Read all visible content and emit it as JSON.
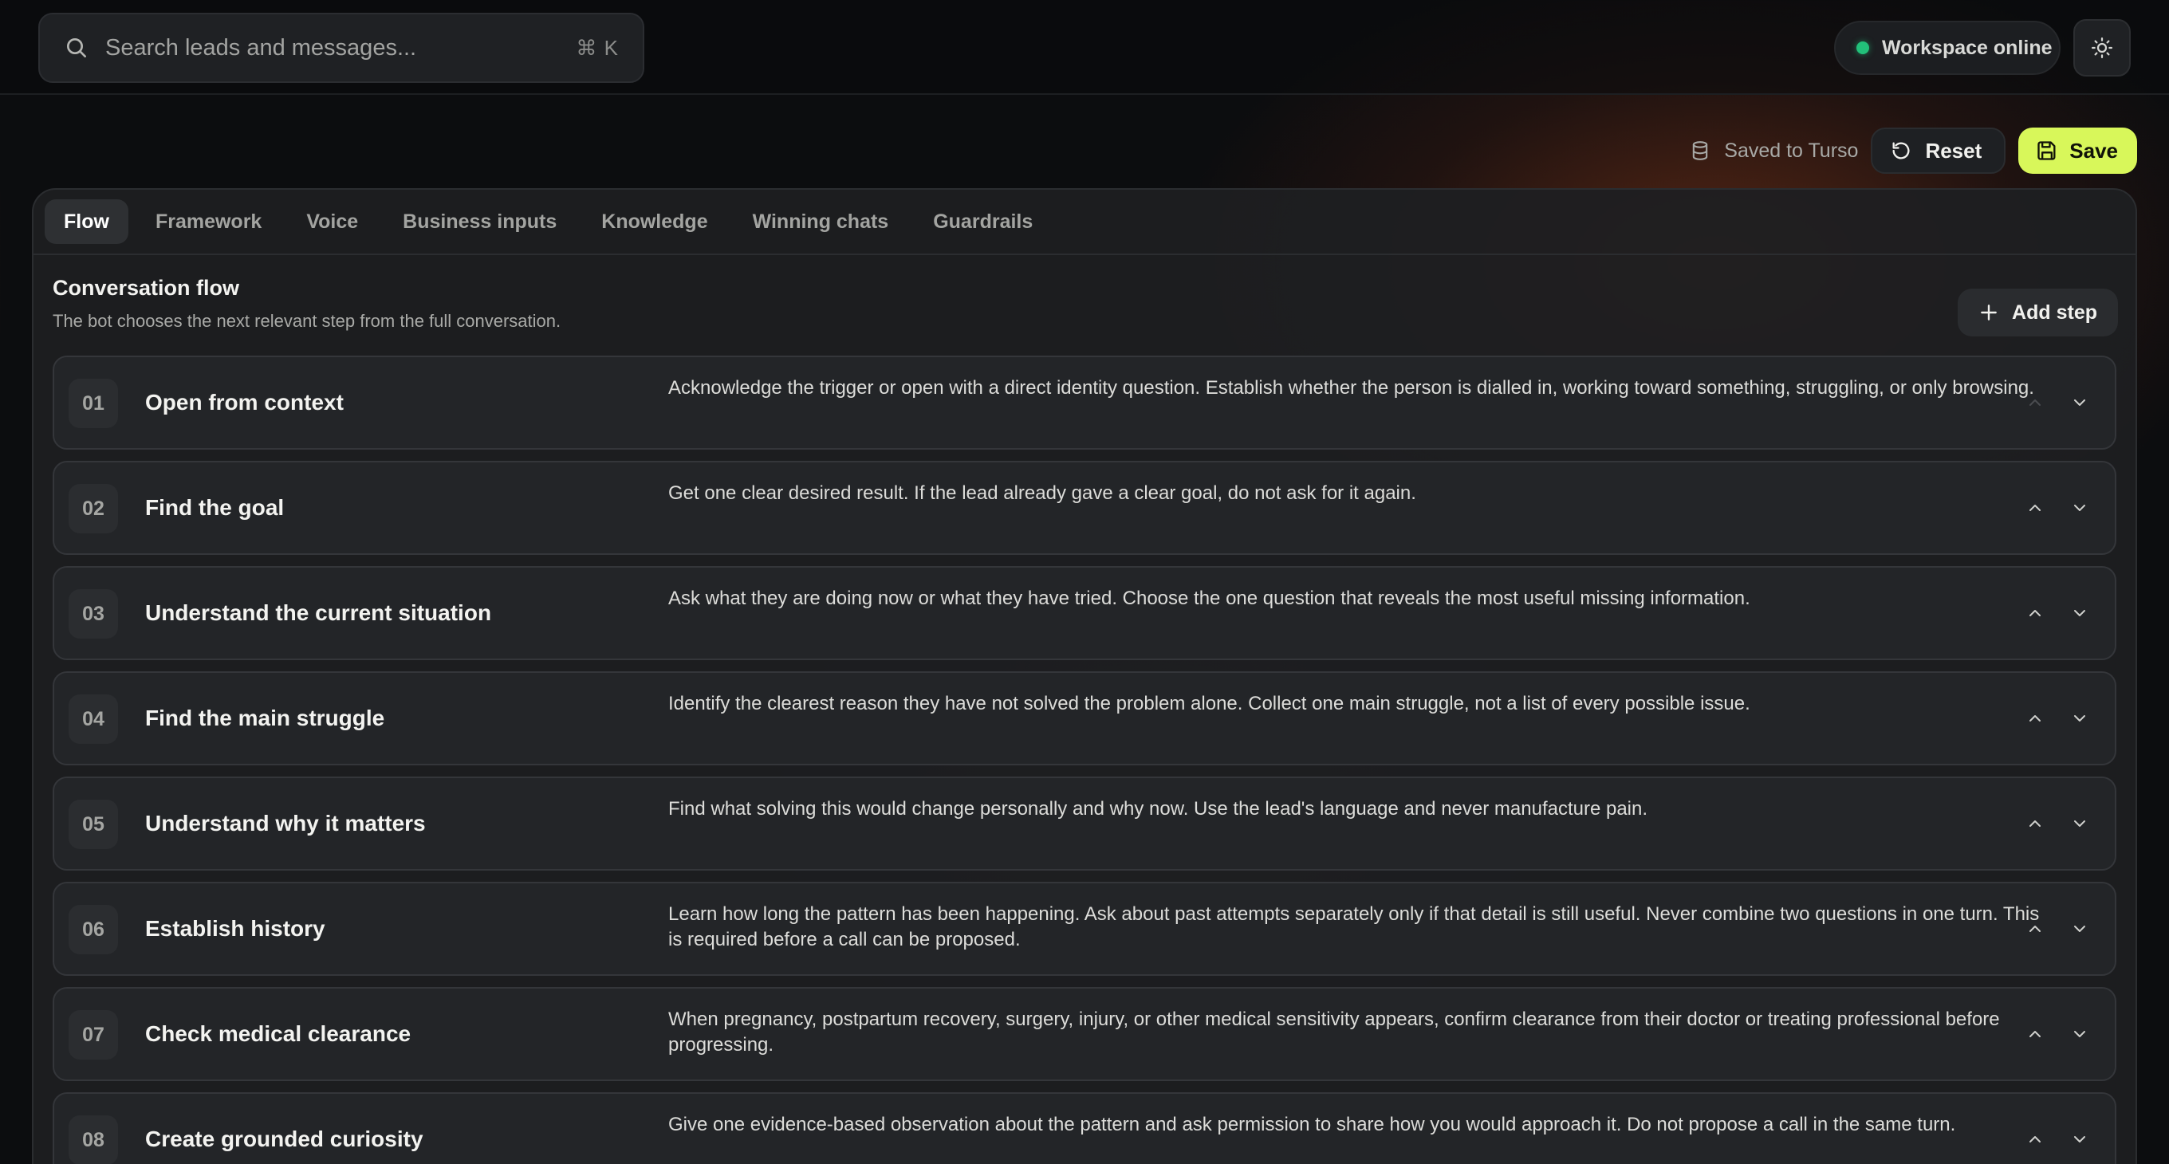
{
  "search": {
    "placeholder": "Search leads and messages...",
    "shortcut": "⌘ K"
  },
  "status": {
    "label": "Workspace online",
    "color": "#22c07a"
  },
  "toolbar": {
    "saved_label": "Saved to Turso",
    "reset_label": "Reset",
    "save_label": "Save",
    "accent": "#d8f75a"
  },
  "tabs": [
    {
      "label": "Flow",
      "active": true
    },
    {
      "label": "Framework"
    },
    {
      "label": "Voice"
    },
    {
      "label": "Business inputs"
    },
    {
      "label": "Knowledge"
    },
    {
      "label": "Winning chats"
    },
    {
      "label": "Guardrails"
    }
  ],
  "flow": {
    "title": "Conversation flow",
    "subtitle": "The bot chooses the next relevant step from the full conversation.",
    "add_step_label": "Add step"
  },
  "steps": [
    {
      "num": "01",
      "title": "Open from context",
      "desc": "Acknowledge the trigger or open with a direct identity question. Establish whether the person is dialled in, working toward something, struggling, or only browsing."
    },
    {
      "num": "02",
      "title": "Find the goal",
      "desc": "Get one clear desired result. If the lead already gave a clear goal, do not ask for it again."
    },
    {
      "num": "03",
      "title": "Understand the current situation",
      "desc": "Ask what they are doing now or what they have tried. Choose the one question that reveals the most useful missing information."
    },
    {
      "num": "04",
      "title": "Find the main struggle",
      "desc": "Identify the clearest reason they have not solved the problem alone. Collect one main struggle, not a list of every possible issue."
    },
    {
      "num": "05",
      "title": "Understand why it matters",
      "desc": "Find what solving this would change personally and why now. Use the lead's language and never manufacture pain."
    },
    {
      "num": "06",
      "title": "Establish history",
      "desc": "Learn how long the pattern has been happening. Ask about past attempts separately only if that detail is still useful. Never combine two questions in one turn. This is required before a call can be proposed."
    },
    {
      "num": "07",
      "title": "Check medical clearance",
      "desc": "When pregnancy, postpartum recovery, surgery, injury, or other medical sensitivity appears, confirm clearance from their doctor or treating professional before progressing."
    },
    {
      "num": "08",
      "title": "Create grounded curiosity",
      "desc": "Give one evidence-based observation about the pattern and ask permission to share how you would approach it. Do not propose a call in the same turn."
    }
  ]
}
